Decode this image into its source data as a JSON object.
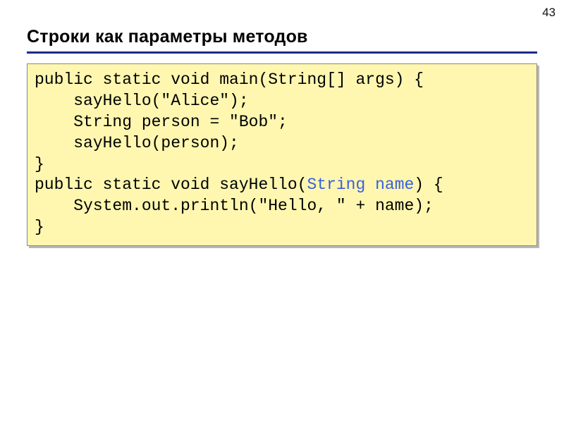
{
  "page_number": "43",
  "title": "Строки как параметры методов",
  "code": {
    "l1a": "public static void main(String[] args) {",
    "l2": "    sayHello(\"Alice\");",
    "l3": "    String person = \"Bob\";",
    "l4": "    sayHello(person);",
    "l5": "}",
    "l6a": "public static void sayHello(",
    "l6b": "String name",
    "l6c": ") {",
    "l7": "    System.out.println(\"Hello, \" + name);",
    "l8": "}"
  }
}
